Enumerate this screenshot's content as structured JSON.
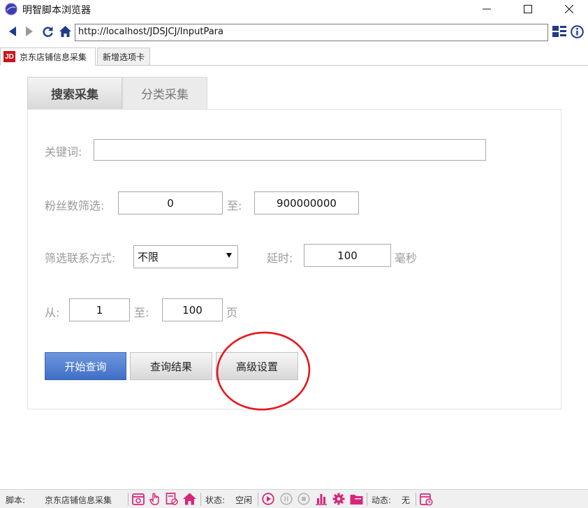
{
  "window": {
    "title": "明智脚本浏览器"
  },
  "navbar": {
    "url": "http://localhost/JDSJCJ/InputPara"
  },
  "browser_tabs": [
    {
      "label": "京东店铺信息采集",
      "icon_text": "JD"
    },
    {
      "label": "新增选项卡"
    }
  ],
  "inner_tabs": [
    {
      "label": "搜索采集"
    },
    {
      "label": "分类采集"
    }
  ],
  "form": {
    "keyword_label": "关键词:",
    "keyword_value": "",
    "fans_label": "粉丝数筛选:",
    "fans_min": "0",
    "fans_to_label": "至:",
    "fans_max": "900000000",
    "contact_label": "筛选联系方式:",
    "contact_selected": "不限",
    "delay_label": "延时:",
    "delay_value": "100",
    "delay_unit": "毫秒",
    "page_from_label": "从:",
    "page_from": "1",
    "page_to_label": "至:",
    "page_to": "100",
    "page_unit": "页"
  },
  "buttons": {
    "start_query": "开始查询",
    "query_result": "查询结果",
    "advanced_settings": "高级设置"
  },
  "status_bar": {
    "script_label": "脚本:",
    "script_name": "京东店铺信息采集",
    "state_label": "状态:",
    "state_value": "空闲",
    "dynamic_label": "动态:",
    "dynamic_value": "无"
  },
  "colors": {
    "accent_pink": "#d6267a",
    "primary_button": "#4f7ed2",
    "annotation_red": "#e8151b"
  }
}
